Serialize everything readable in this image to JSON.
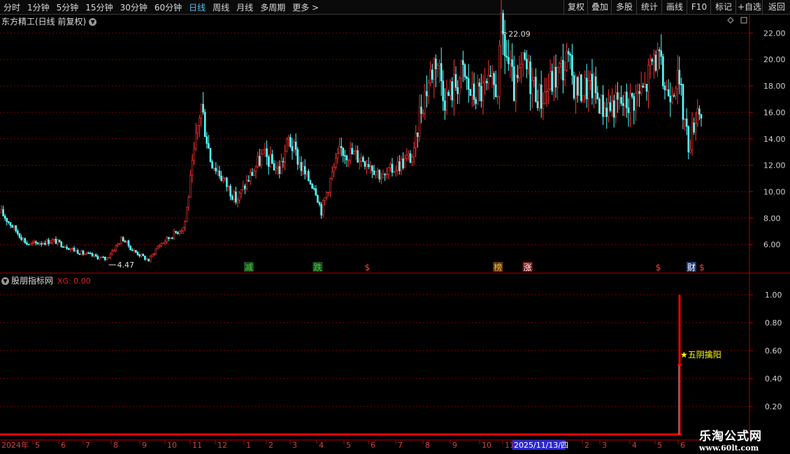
{
  "toolbar": {
    "periods": [
      "分时",
      "1分钟",
      "5分钟",
      "15分钟",
      "30分钟",
      "60分钟",
      "日线",
      "周线",
      "月线",
      "多周期",
      "更多 >"
    ],
    "active_period": "日线",
    "right_buttons": [
      "复权",
      "叠加",
      "多股",
      "统计",
      "画线",
      "F10",
      "标记",
      "+自选",
      "返回"
    ]
  },
  "main_panel": {
    "title": "东方精工(日线 前复权)",
    "max_marker": "22.09",
    "min_marker": "4.47",
    "event_tags": [
      {
        "label": "减",
        "color": "#3ad13a",
        "bg": "#1f4a1f"
      },
      {
        "label": "跌",
        "color": "#3ad13a",
        "bg": "#1f4a1f"
      },
      {
        "label": "$",
        "color": "#ff3b3b",
        "bg": ""
      },
      {
        "label": "榜",
        "color": "#ffb347",
        "bg": "#5a3a10"
      },
      {
        "label": "涨",
        "color": "#ffffff",
        "bg": "#7a1a1a"
      },
      {
        "label": "$",
        "color": "#ff3b3b",
        "bg": ""
      },
      {
        "label": "财",
        "color": "#ffffff",
        "bg": "#1f3f7a"
      },
      {
        "label": "$",
        "color": "#ff3b3b",
        "bg": ""
      }
    ]
  },
  "indicator_panel": {
    "title": "股朋指标网",
    "value_label": "XG: 0.00",
    "signal_label": "★五阴擒阳"
  },
  "x_axis": {
    "labels": [
      "2024年",
      "5",
      "6",
      "7",
      "8",
      "9",
      "10",
      "11",
      "12",
      "1",
      "2",
      "3",
      "4",
      "5",
      "6",
      "7",
      "8",
      "9",
      "10",
      "11",
      "2025/11/13/四",
      "2",
      "3",
      "4",
      "5",
      "6"
    ]
  },
  "watermark": {
    "line1": "乐淘公式网",
    "line2": "www.60lt.com"
  },
  "colors": {
    "up": "#ff3232",
    "down": "#54ffff",
    "grid": "#7a0000",
    "axis": "#b00000",
    "signal": "#ff0000",
    "signal_label": "#ffff00"
  },
  "chart_data": [
    {
      "type": "candlestick",
      "title": "东方精工(日线 前复权)",
      "ylim": [
        4.0,
        22.6
      ],
      "y_ticks": [
        "6.00",
        "8.00",
        "10.00",
        "12.00",
        "14.00",
        "16.00",
        "18.00",
        "20.00",
        "22.00"
      ],
      "x_range": [
        "2024-04",
        "2026-06"
      ],
      "price_path": [
        [
          "2024-04",
          8.4
        ],
        [
          "2024-05",
          6.0
        ],
        [
          "2024-06",
          6.3
        ],
        [
          "2024-07",
          5.4
        ],
        [
          "2024-08",
          4.9
        ],
        [
          "2024-08-20",
          6.5
        ],
        [
          "2024-09",
          5.6
        ],
        [
          "2024-09-20",
          4.8
        ],
        [
          "2024-10",
          5.9
        ],
        [
          "2024-11",
          7.4
        ],
        [
          "2024-11-20",
          16.7
        ],
        [
          "2024-12",
          12.5
        ],
        [
          "2025-01",
          9.3
        ],
        [
          "2025-01-15",
          11.0
        ],
        [
          "2025-02",
          12.8
        ],
        [
          "2025-02-20",
          11.6
        ],
        [
          "2025-03",
          14.0
        ],
        [
          "2025-03-20",
          11.2
        ],
        [
          "2025-04",
          10.4
        ],
        [
          "2025-04-08",
          8.5
        ],
        [
          "2025-04-20",
          11.2
        ],
        [
          "2025-05",
          13.2
        ],
        [
          "2025-06",
          12.4
        ],
        [
          "2025-06-20",
          11.0
        ],
        [
          "2025-07",
          11.8
        ],
        [
          "2025-07-25",
          12.8
        ],
        [
          "2025-08",
          16.0
        ],
        [
          "2025-08-20",
          20.4
        ],
        [
          "2025-09",
          17.0
        ],
        [
          "2025-09-20",
          19.0
        ],
        [
          "2025-10",
          17.3
        ],
        [
          "2025-11",
          18.0
        ],
        [
          "2025-11-05",
          22.09
        ],
        [
          "2025-11-20",
          17.4
        ],
        [
          "2025-12",
          19.6
        ],
        [
          "2025-12-20",
          17.0
        ],
        [
          "2026-01",
          18.2
        ],
        [
          "2026-01-20",
          19.8
        ],
        [
          "2026-02",
          17.8
        ],
        [
          "2026-02-20",
          17.9
        ],
        [
          "2026-03",
          16.4
        ],
        [
          "2026-04",
          16.8
        ],
        [
          "2026-04-20",
          17.8
        ],
        [
          "2026-05",
          20.5
        ],
        [
          "2026-05-15",
          17.5
        ],
        [
          "2026-05-25",
          18.8
        ],
        [
          "2026-06",
          17.2
        ],
        [
          "2026-06-10",
          13.4
        ],
        [
          "2026-06-20",
          16.5
        ],
        [
          "2026-06-25",
          16.0
        ]
      ],
      "annotations": [
        {
          "label": "22.09",
          "type": "max"
        },
        {
          "label": "4.47",
          "type": "min"
        }
      ]
    },
    {
      "type": "line",
      "title": "股朋指标网",
      "series": [
        {
          "name": "XG",
          "values_description_only": "0 except spike",
          "spike_value": 1.0,
          "last_value": 0.0
        }
      ],
      "ylim": [
        0,
        1.08
      ],
      "y_ticks": [
        "0.20",
        "0.40",
        "0.60",
        "0.80",
        "1.00"
      ],
      "signal": {
        "label": "★五阴擒阳",
        "value": 1.0
      }
    }
  ]
}
